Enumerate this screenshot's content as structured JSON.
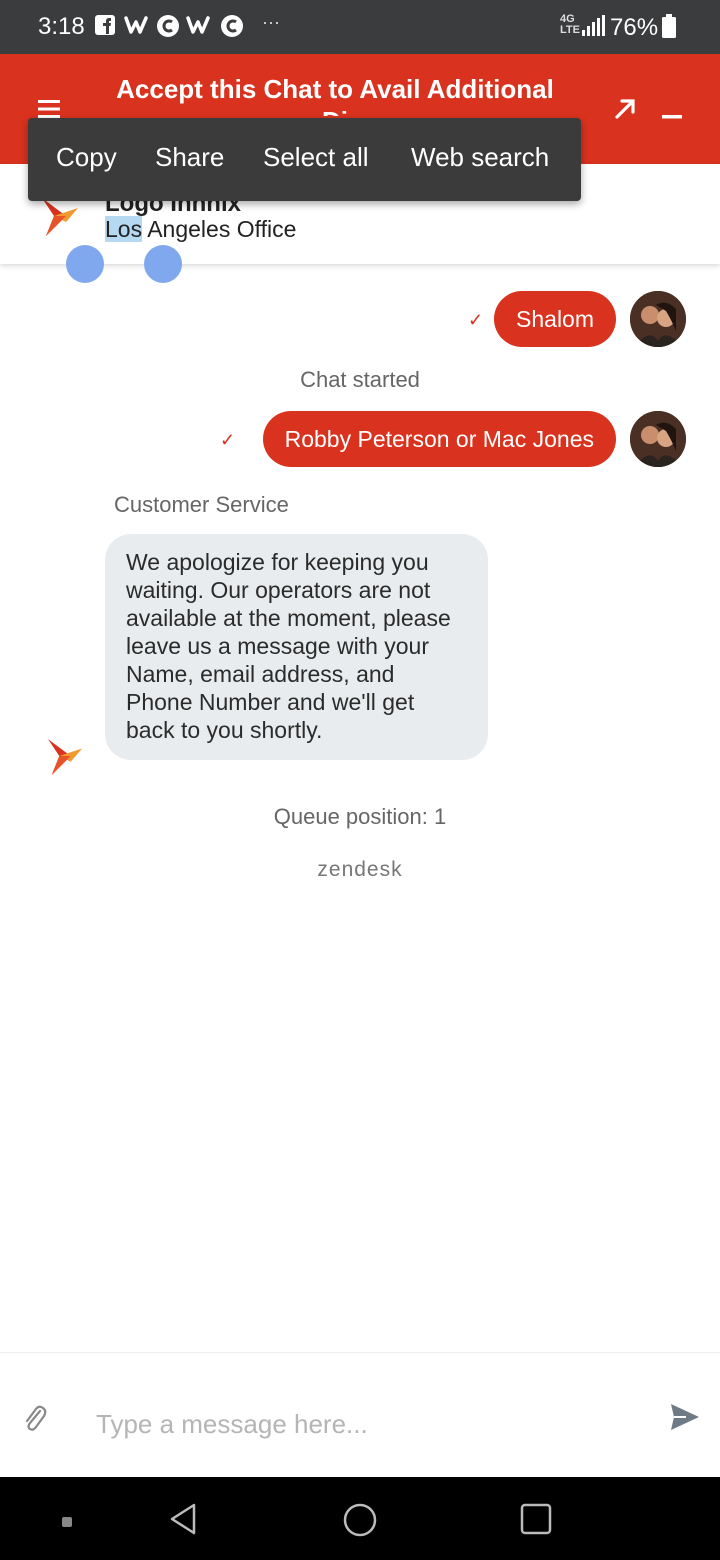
{
  "status_bar": {
    "time": "3:18",
    "notification_icons": [
      "facebook-icon",
      "wattpad-icon",
      "c-icon",
      "wattpad-icon",
      "c-icon"
    ],
    "more": "···",
    "network": "4G LTE",
    "battery_percent": "76%"
  },
  "header": {
    "title": "Accept this Chat to Avail Additional",
    "title_line2": "Di",
    "accent_color": "#d9321e"
  },
  "context_menu": {
    "items": [
      "Copy",
      "Share",
      "Select all",
      "Web search"
    ]
  },
  "agent": {
    "name": "Logo Innnix",
    "subtitle_selected": "Los",
    "subtitle_rest": " Angeles Office"
  },
  "messages": {
    "out_1": "Shalom",
    "system_1": "Chat started",
    "out_2": "Robby Peterson or Mac Jones",
    "sender_label": "Customer Service",
    "in_1": "We apologize for keeping you waiting. Our operators are not available at the moment, please leave us a message with your Name, email address, and Phone Number and we'll get back to you shortly.",
    "queue": "Queue position: 1",
    "branding": "zendesk"
  },
  "composer": {
    "placeholder": "Type a message here..."
  }
}
